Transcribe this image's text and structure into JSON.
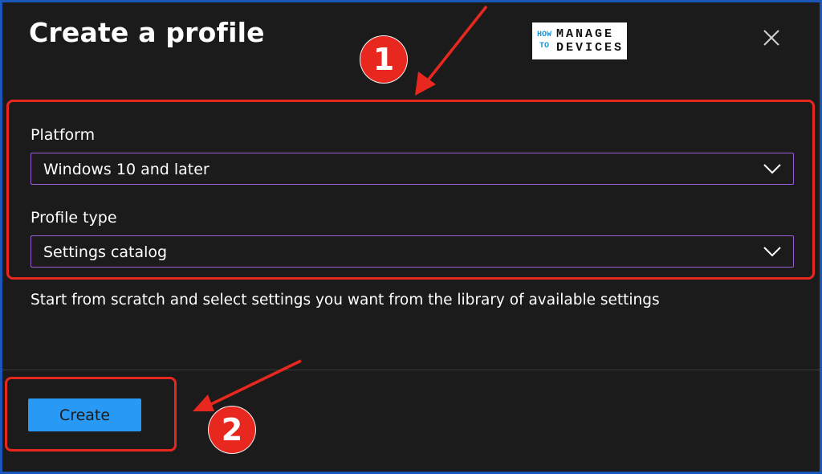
{
  "dialog": {
    "title": "Create a profile",
    "close_icon": "close-icon"
  },
  "logo": {
    "line1_small": "HOW",
    "line2_small": "TO",
    "line1_main": "MANAGE",
    "line2_main": "DEVICES"
  },
  "form": {
    "platform_label": "Platform",
    "platform_value": "Windows 10 and later",
    "profile_type_label": "Profile type",
    "profile_type_value": "Settings catalog",
    "description": "Start from scratch and select settings you want from the library of available settings"
  },
  "footer": {
    "create_label": "Create"
  },
  "annotations": {
    "step1": "1",
    "step2": "2"
  },
  "colors": {
    "background": "#1b1b1b",
    "accent_blue": "#2899f5",
    "select_border": "#9a5fd6",
    "annotation_red": "#e8271f",
    "frame_border": "#1a56b8"
  },
  "icons": {
    "dropdown": "chevron-down-icon",
    "close": "close-icon"
  }
}
